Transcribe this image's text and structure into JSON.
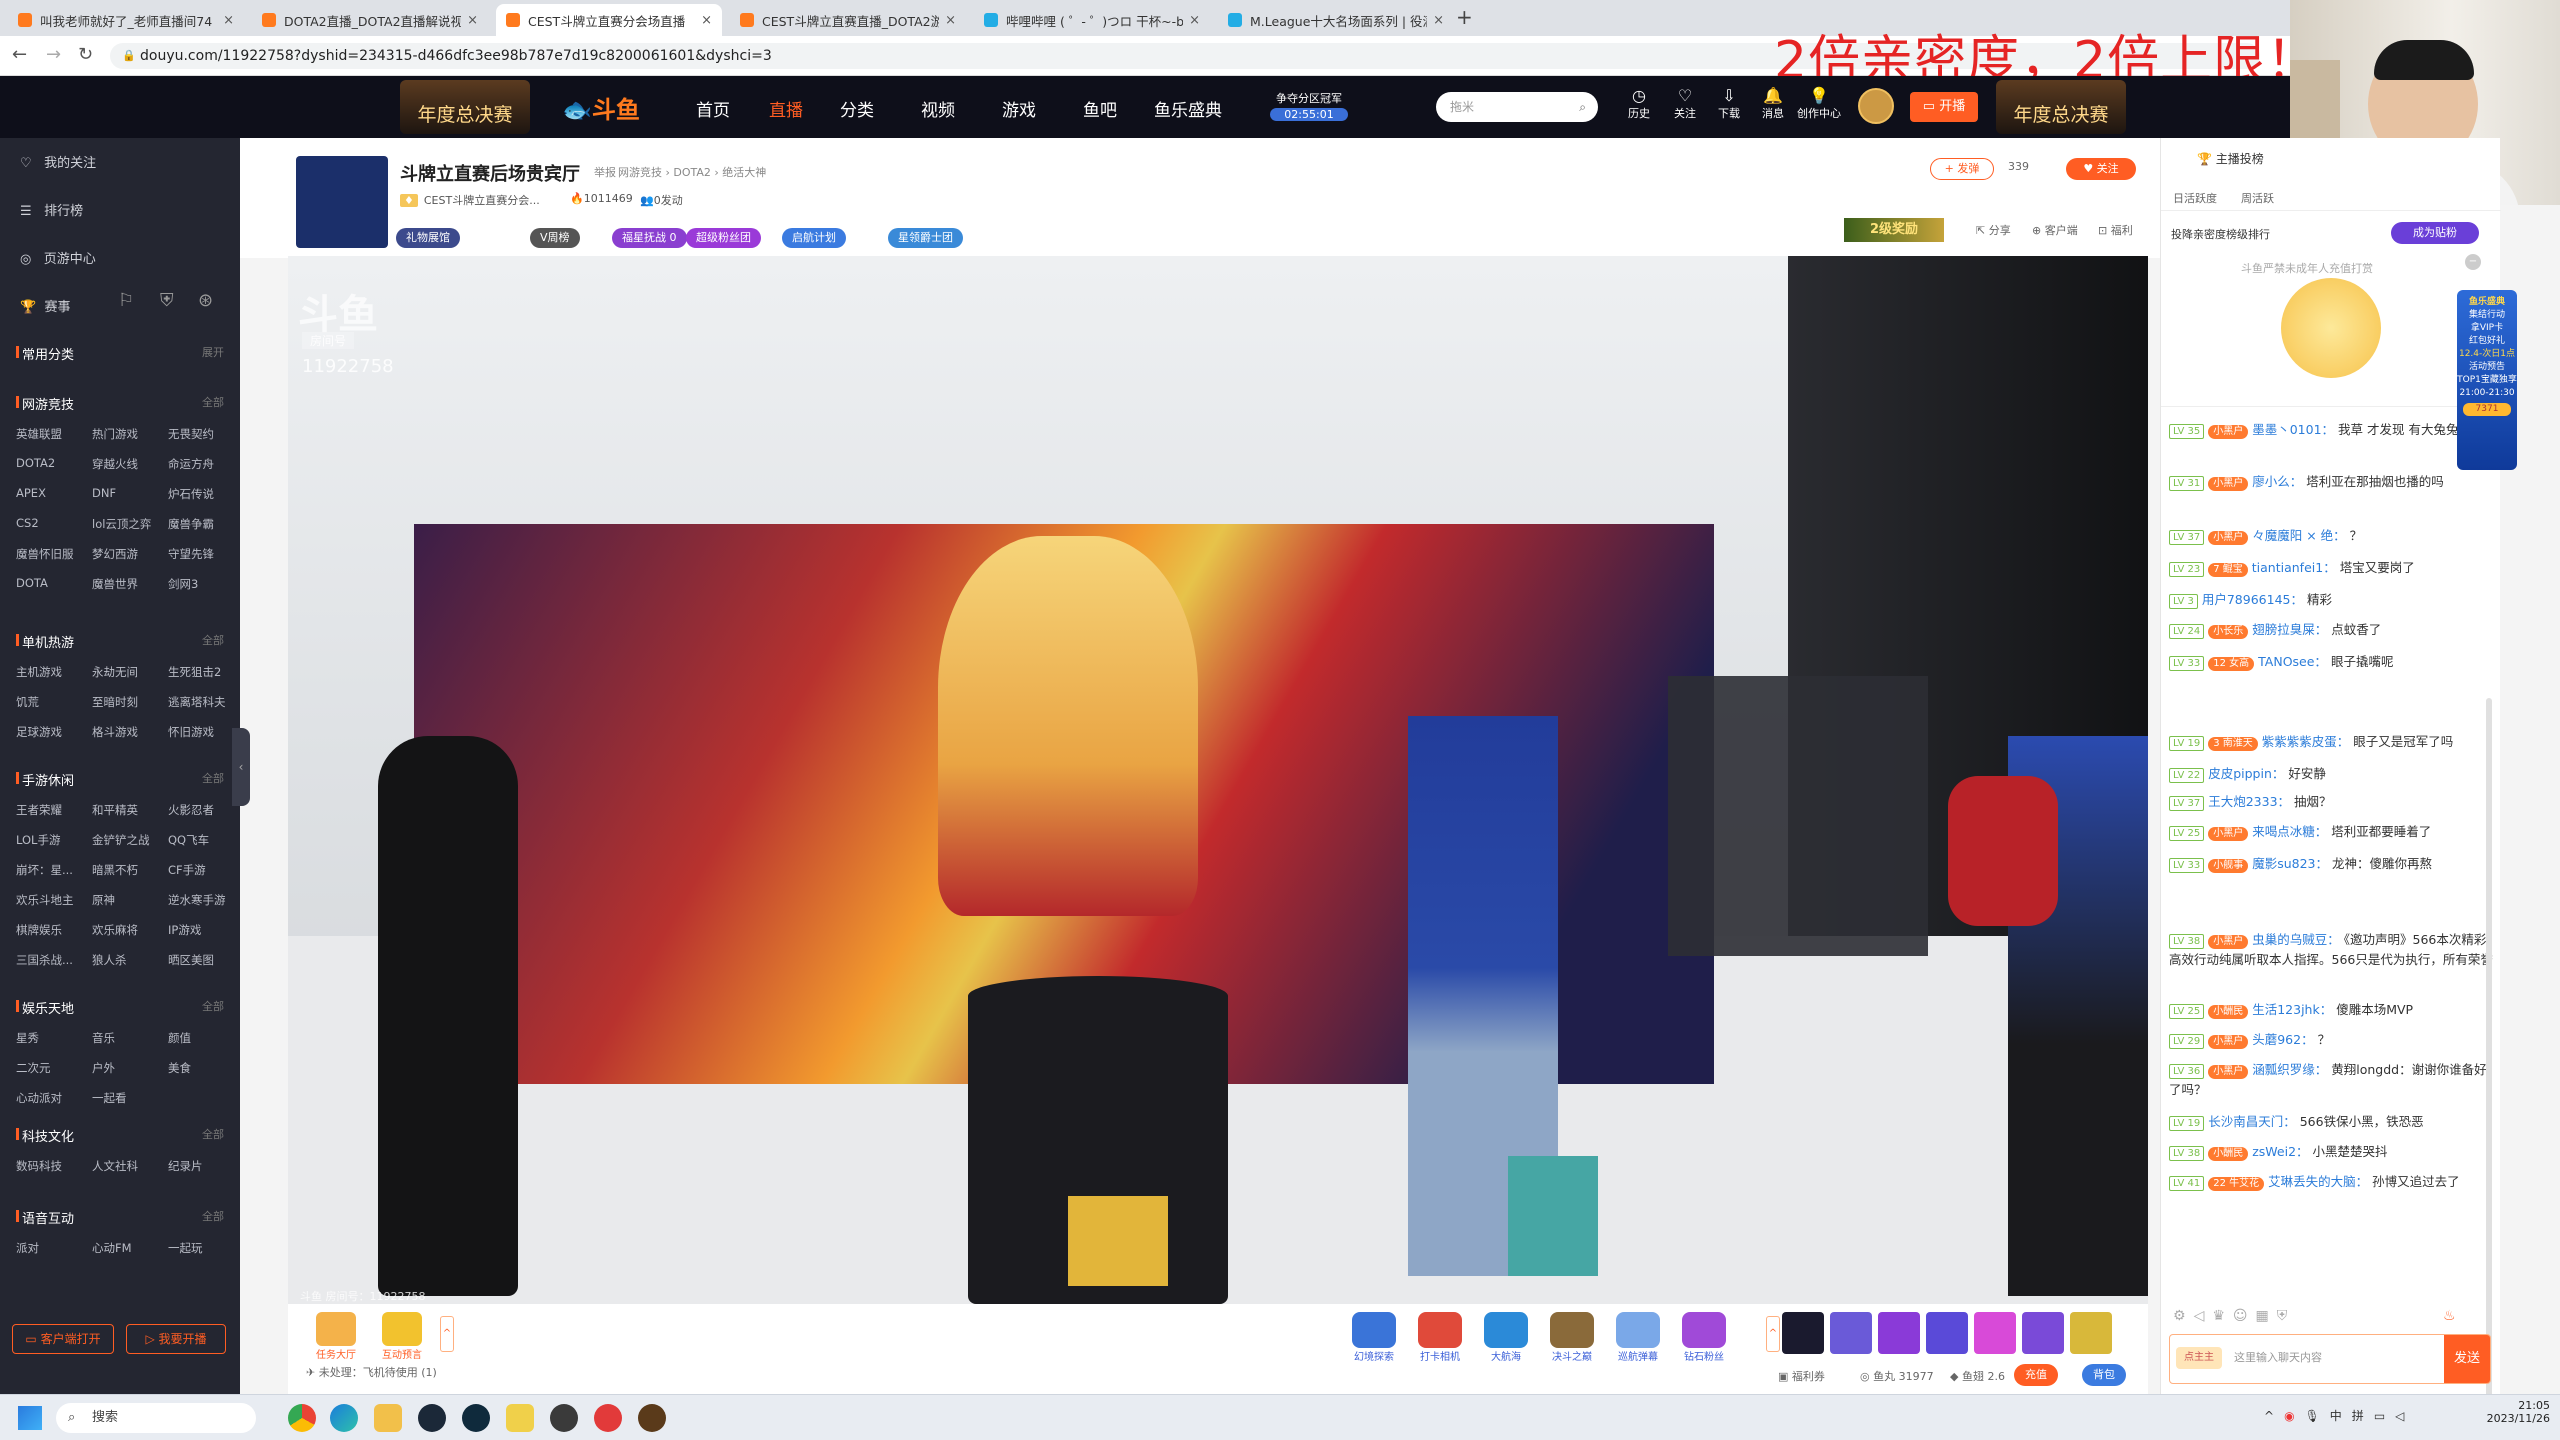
{
  "browser": {
    "tabs": [
      {
        "title": "叫我老师就好了_老师直播间74"
      },
      {
        "title": "DOTA2直播_DOTA2直播解说视"
      },
      {
        "title": "CEST斗牌立直赛分会场直播"
      },
      {
        "title": "CEST斗牌立直赛直播_DOTA2游"
      },
      {
        "title": "哔哩哔哩 ( ゜- ゜)つロ 干杯~-bil"
      },
      {
        "title": "M.League十大名场面系列 | 役满"
      }
    ],
    "url": "douyu.com/11922758?dyshid=234315-d466dfc3ee98b787e7d19c8200061601&dyshci=3"
  },
  "overlay_text": "2倍亲密度，2倍上限！",
  "header": {
    "logo": "斗鱼",
    "banner_left": "年度总决赛",
    "banner_right": "年度总决赛",
    "nav": [
      "首页",
      "直播",
      "分类",
      "视频",
      "游戏",
      "鱼吧",
      "鱼乐盛典"
    ],
    "promo_title": "争夺分区冠军",
    "promo_timer": "02:55:01",
    "search_placeholder": "拖米",
    "icons": [
      "历史",
      "关注",
      "下载",
      "消息",
      "创作中心"
    ],
    "open_btn": "开播"
  },
  "sidebar": {
    "top": [
      "我的关注",
      "排行榜",
      "页游中心",
      "赛事"
    ],
    "common": "常用分类",
    "common_more": "展开",
    "sections": [
      {
        "title": "网游竞技",
        "more": "全部",
        "items": [
          "英雄联盟",
          "热门游戏",
          "无畏契约",
          "DOTA2",
          "穿越火线",
          "命运方舟",
          "APEX",
          "DNF",
          "炉石传说",
          "CS2",
          "lol云顶之弈",
          "魔兽争霸",
          "魔兽怀旧服",
          "梦幻西游",
          "守望先锋",
          "DOTA",
          "魔兽世界",
          "剑网3"
        ]
      },
      {
        "title": "单机热游",
        "more": "全部",
        "items": [
          "主机游戏",
          "永劫无间",
          "生死狙击2",
          "饥荒",
          "至暗时刻",
          "逃离塔科夫",
          "足球游戏",
          "格斗游戏",
          "怀旧游戏"
        ]
      },
      {
        "title": "手游休闲",
        "more": "全部",
        "items": [
          "王者荣耀",
          "和平精英",
          "火影忍者",
          "LOL手游",
          "金铲铲之战",
          "QQ飞车",
          "崩坏：星...",
          "暗黑不朽",
          "CF手游",
          "欢乐斗地主",
          "原神",
          "逆水寒手游",
          "棋牌娱乐",
          "欢乐麻将",
          "IP游戏",
          "三国杀战...",
          "狼人杀",
          "晒区美图"
        ]
      },
      {
        "title": "娱乐天地",
        "more": "全部",
        "items": [
          "星秀",
          "音乐",
          "颜值",
          "二次元",
          "户外",
          "美食",
          "心动派对",
          "一起看"
        ]
      },
      {
        "title": "科技文化",
        "more": "全部",
        "items": [
          "数码科技",
          "人文社科",
          "纪录片"
        ]
      },
      {
        "title": "语音互动",
        "more": "全部",
        "items": [
          "派对",
          "心动FM",
          "一起玩"
        ]
      }
    ],
    "btn_client": "客户端打开",
    "btn_live": "我要开播"
  },
  "room": {
    "title": "斗牌立直赛后场贵宾厅",
    "report": "举报",
    "crumbs": "网游竞技 › DOTA2 › 绝活大神",
    "streamer": "CEST斗牌立直赛分会...",
    "hot": "1011469",
    "follow_count": "0发动",
    "fans_group": "339",
    "follow_btn": "关注",
    "share_btn": "发弹",
    "pills": [
      "礼物展馆",
      "V周榜",
      "福星抚战 0",
      "超级粉丝团",
      "启航计划",
      "星领爵士团"
    ],
    "level_badge": "2级奖励",
    "actions": [
      "分享",
      "客户端",
      "福利"
    ],
    "room_id": "11922758",
    "watermark": "房间号",
    "bar_left": "斗鱼 房间号：11922758"
  },
  "controls": {
    "left_icons": [
      "任务大厅",
      "互动预言"
    ],
    "gift_icons": [
      "幻境探索",
      "打卡相机",
      "大航海",
      "决斗之巅",
      "巡航弹幕",
      "钻石粉丝"
    ],
    "status": "未处理：飞机待使用 (1)",
    "bottom": [
      "福利券",
      "鱼丸 31977",
      "鱼翅 2.6",
      "充值",
      "背包"
    ]
  },
  "chat": {
    "tabs": [
      "日活跃度",
      "周活跃"
    ],
    "anchor_task": "主播投榜",
    "rank_title": "投降亲密度榜级排行",
    "rank_btn": "成为贴粉",
    "subtitle": "斗鱼严禁未成年人充值打赏",
    "messages": [
      {
        "lv": "LV 35",
        "badge": "小黑户",
        "name": "墨墨丶0101：",
        "text": "我草 才发现 有大兔兔看"
      },
      {
        "lv": "LV 31",
        "badge": "小黑户",
        "name": "廖小么：",
        "text": "塔利亚在那抽烟也播的吗"
      },
      {
        "lv": "LV 37",
        "badge": "小黑户",
        "name": "々魔魔阳 × 绝：",
        "text": "？"
      },
      {
        "lv": "LV 23",
        "badge": "7 鲲宝",
        "name": "tiantianfei1：",
        "text": "塔宝又要岗了"
      },
      {
        "lv": "LV 3",
        "badge": "",
        "name": "用户78966145：",
        "text": "精彩"
      },
      {
        "lv": "LV 24",
        "badge": "小长乐",
        "name": "翅膀拉臭屎：",
        "text": "点蚊香了"
      },
      {
        "lv": "LV 33",
        "badge": "12 女高",
        "name": "TANOsee：",
        "text": "眼子撬嘴呢"
      },
      {
        "lv": "LV 19",
        "badge": "3 南淮天",
        "name": "紫紫紫紫皮蛋：",
        "text": "眼子又是冠军了吗"
      },
      {
        "lv": "LV 22",
        "badge": "",
        "name": "皮皮pippin：",
        "text": "好安静"
      },
      {
        "lv": "LV 37",
        "badge": "",
        "name": "王大炮2333：",
        "text": "抽烟？"
      },
      {
        "lv": "LV 25",
        "badge": "小黑户",
        "name": "来喝点冰糖：",
        "text": "塔利亚都要睡着了"
      },
      {
        "lv": "LV 33",
        "badge": "小舰事",
        "name": "魔影su823：",
        "text": "龙神：傻雕你再熬"
      },
      {
        "lv": "LV 38",
        "badge": "小黑户",
        "name": "虫巢的乌贼豆：",
        "text": "《邀功声明》566本次精彩高效行动纯属听取本人指挥。566只是代为执行，所有荣誉"
      },
      {
        "lv": "LV 25",
        "badge": "小酬民",
        "name": "生活123jhk：",
        "text": "傻雕本场MVP"
      },
      {
        "lv": "LV 29",
        "badge": "小黑户",
        "name": "头蘑962：",
        "text": "？"
      },
      {
        "lv": "LV 36",
        "badge": "小黑户",
        "name": "涵瓢织罗缘：",
        "text": "黄翔longdd：谢谢你谁备好了吗？"
      },
      {
        "lv": "LV 19",
        "badge": "",
        "name": "长沙南昌天门：",
        "text": "566铁保小黑，铁恐恶"
      },
      {
        "lv": "LV 38",
        "badge": "小酬民",
        "name": "zsWei2：",
        "text": "小黑楚楚哭抖"
      },
      {
        "lv": "LV 41",
        "badge": "22 牛艾花",
        "name": "艾琳丢失的大脑：",
        "text": "孙博又追过去了"
      }
    ],
    "input_placeholder": "这里输入聊天内容",
    "send_btn": "发送",
    "user_badge": "点主主",
    "side_promo": {
      "title": "鱼乐盛典",
      "line1": "集结行动",
      "line2": "拿VIP卡",
      "line3": "红包好礼",
      "line4": "12.4-次日1点",
      "line5": "活动预告",
      "line6": "TOP1宝藏独享",
      "line7": "21:00-21:30",
      "count": "7371"
    }
  },
  "taskbar": {
    "search": "搜索",
    "tray": [
      "中",
      "拼"
    ],
    "time": "21:05",
    "date": "2023/11/26"
  }
}
